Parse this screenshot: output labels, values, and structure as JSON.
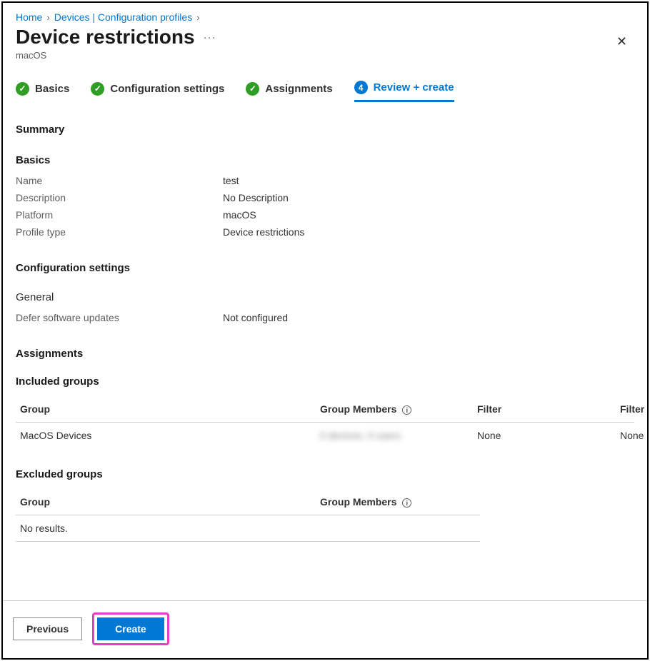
{
  "breadcrumb": {
    "home": "Home",
    "devices": "Devices | Configuration profiles"
  },
  "header": {
    "title": "Device restrictions",
    "subtitle": "macOS"
  },
  "tabs": {
    "basics": "Basics",
    "config": "Configuration settings",
    "assignments": "Assignments",
    "review_num": "4",
    "review": "Review + create"
  },
  "sections": {
    "summary": "Summary",
    "basics": "Basics",
    "config": "Configuration settings",
    "general": "General",
    "assignments": "Assignments",
    "included": "Included groups",
    "excluded": "Excluded groups"
  },
  "basics_rows": {
    "name_k": "Name",
    "name_v": "test",
    "desc_k": "Description",
    "desc_v": "No Description",
    "plat_k": "Platform",
    "plat_v": "macOS",
    "ptype_k": "Profile type",
    "ptype_v": "Device restrictions"
  },
  "config_rows": {
    "defer_k": "Defer software updates",
    "defer_v": "Not configured"
  },
  "included_table": {
    "h_group": "Group",
    "h_members": "Group Members",
    "h_filter": "Filter",
    "h_filter2": "Filter",
    "row_group": "MacOS Devices",
    "row_members": "0 devices, 0 users",
    "row_filter": "None",
    "row_filter2": "None"
  },
  "excluded_table": {
    "h_group": "Group",
    "h_members": "Group Members",
    "noresults": "No results."
  },
  "footer": {
    "previous": "Previous",
    "create": "Create"
  }
}
